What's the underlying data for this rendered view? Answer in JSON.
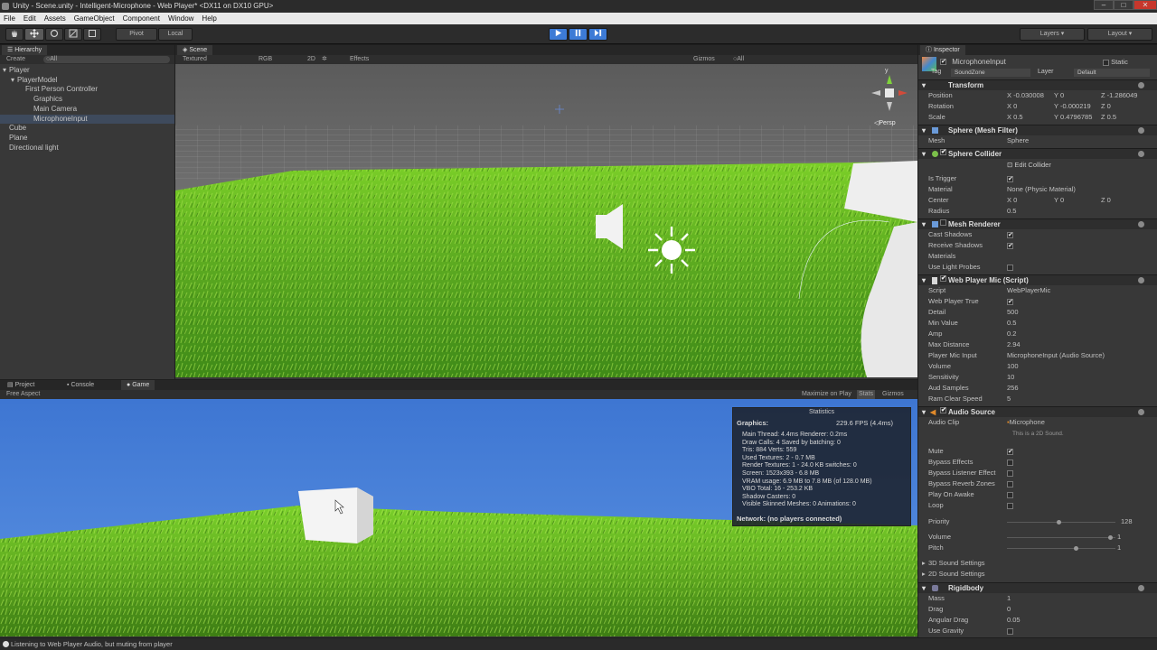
{
  "window": {
    "title": "Unity - Scene.unity - Intelligent-Microphone - Web Player* <DX11 on DX10 GPU>",
    "minimize": "–",
    "maximize": "□",
    "close": "✕"
  },
  "menu": [
    "File",
    "Edit",
    "Assets",
    "GameObject",
    "Component",
    "Window",
    "Help"
  ],
  "toolbar": {
    "pivot": "Pivot",
    "local": "Local",
    "layers": "Layers",
    "layout": "Layout"
  },
  "hierarchy": {
    "tab": "Hierarchy",
    "create": "Create",
    "search": "○All",
    "items": [
      {
        "label": "Player",
        "indent": 0
      },
      {
        "label": "PlayerModel",
        "indent": 1
      },
      {
        "label": "First Person Controller",
        "indent": 2
      },
      {
        "label": "Graphics",
        "indent": 3
      },
      {
        "label": "Main Camera",
        "indent": 3
      },
      {
        "label": "MicrophoneInput",
        "indent": 3,
        "selected": true
      },
      {
        "label": "Cube",
        "indent": 0
      },
      {
        "label": "Plane",
        "indent": 0
      },
      {
        "label": "Directional light",
        "indent": 0
      }
    ]
  },
  "scene": {
    "tab": "Scene",
    "shading": "Textured",
    "rgb": "RGB",
    "mode2d": "2D",
    "effects": "Effects",
    "gizmos": "Gizmos",
    "search": "○All",
    "persp": "◁Persp",
    "gizmo_y": "y"
  },
  "bottom": {
    "tabs": [
      "Project",
      "Console",
      "Game"
    ],
    "aspect": "Free Aspect",
    "maximize_on_play": "Maximize on Play",
    "stats": "Stats",
    "gizmos": "Gizmos"
  },
  "statistics": {
    "header": "Statistics",
    "graphics_label": "Graphics:",
    "fps": "229.6 FPS (4.4ms)",
    "lines": [
      "Main Thread: 4.4ms  Renderer: 0.2ms",
      "Draw Calls: 4        Saved by batching: 0",
      "Tris: 884  Verts: 559",
      "Used Textures: 2 - 0.7 MB",
      "Render Textures: 1 - 24.0 KB    switches: 0",
      "Screen: 1523x393 - 6.8 MB",
      "VRAM usage: 6.9 MB to 7.8 MB (of 128.0 MB)",
      "VBO Total: 16 - 253.2 KB",
      "Shadow Casters: 0",
      "Visible Skinned Meshes: 0          Animations: 0"
    ],
    "network": "Network: (no players connected)"
  },
  "inspector": {
    "tab": "Inspector",
    "object_name": "MicrophoneInput",
    "static": "Static",
    "tag_label": "Tag",
    "tag_value": "SoundZone",
    "layer_label": "Layer",
    "layer_value": "Default",
    "transform": {
      "header": "Transform",
      "rows": [
        {
          "label": "Position",
          "x": "X -0.030008",
          "y": "Y 0",
          "z": "Z -1.286049"
        },
        {
          "label": "Rotation",
          "x": "X 0",
          "y": "Y -0.000219",
          "z": "Z 0"
        },
        {
          "label": "Scale",
          "x": "X 0.5",
          "y": "Y 0.4796785",
          "z": "Z 0.5"
        }
      ]
    },
    "mesh_filter": {
      "header": "Sphere (Mesh Filter)",
      "mesh_label": "Mesh",
      "mesh_value": "Sphere"
    },
    "sphere_collider": {
      "header": "Sphere Collider",
      "edit": "Edit Collider",
      "is_trigger": "Is Trigger",
      "material_label": "Material",
      "material_value": "None (Physic Material)",
      "center_label": "Center",
      "center_x": "X 0",
      "center_y": "Y 0",
      "center_z": "Z 0",
      "radius_label": "Radius",
      "radius_value": "0.5"
    },
    "mesh_renderer": {
      "header": "Mesh Renderer",
      "cast_shadows": "Cast Shadows",
      "receive_shadows": "Receive Shadows",
      "materials": "Materials",
      "light_probes": "Use Light Probes"
    },
    "script": {
      "header": "Web Player Mic (Script)",
      "rows": [
        {
          "label": "Script",
          "value": "WebPlayerMic"
        },
        {
          "label": "Web Player True",
          "value": "✔"
        },
        {
          "label": "Detail",
          "value": "500"
        },
        {
          "label": "Min Value",
          "value": "0.5"
        },
        {
          "label": "Amp",
          "value": "0.2"
        },
        {
          "label": "Max Distance",
          "value": "2.94"
        },
        {
          "label": "Player Mic Input",
          "value": "MicrophoneInput (Audio Source)"
        },
        {
          "label": "Volume",
          "value": "100"
        },
        {
          "label": "Sensitivity",
          "value": "10"
        },
        {
          "label": "Aud Samples",
          "value": "256"
        },
        {
          "label": "Ram Clear Speed",
          "value": "5"
        }
      ]
    },
    "audio_source": {
      "header": "Audio Source",
      "clip_label": "Audio Clip",
      "clip_value": "Microphone",
      "clip_note": "This is a 2D Sound.",
      "toggles": [
        "Mute",
        "Bypass Effects",
        "Bypass Listener Effect",
        "Bypass Reverb Zones",
        "Play On Awake",
        "Loop"
      ],
      "priority_label": "Priority",
      "priority_value": "128",
      "volume_label": "Volume",
      "volume_value": "1",
      "pitch_label": "Pitch",
      "pitch_value": "1",
      "settings3d": "3D Sound Settings",
      "settings2d": "2D Sound Settings"
    },
    "rigidbody": {
      "header": "Rigidbody",
      "rows": [
        {
          "label": "Mass",
          "value": "1"
        },
        {
          "label": "Drag",
          "value": "0"
        },
        {
          "label": "Angular Drag",
          "value": "0.05"
        },
        {
          "label": "Use Gravity",
          "value": ""
        }
      ]
    }
  },
  "status": {
    "message": "Listening to Web Player Audio, but muting from player"
  },
  "colors": {
    "accent": "#3d7bd6",
    "sky": "#4a7fd6",
    "grass": "#6bb82a"
  }
}
